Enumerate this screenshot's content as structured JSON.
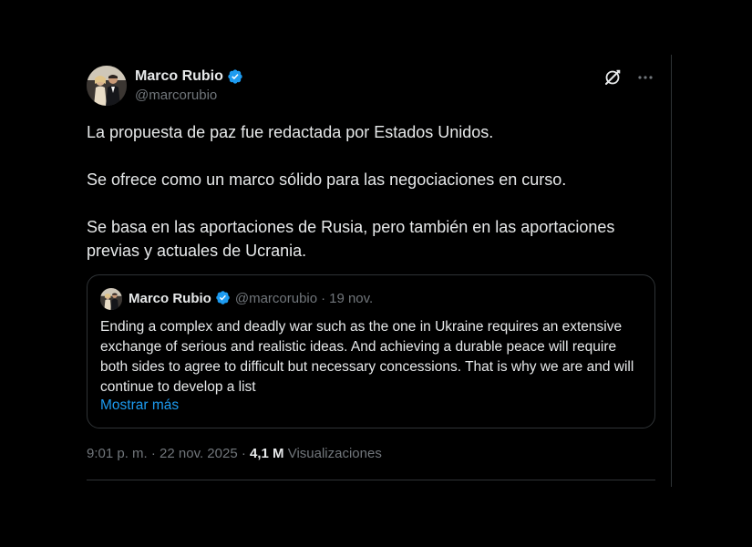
{
  "author": {
    "display_name": "Marco Rubio",
    "handle": "@marcorubio"
  },
  "icons": {
    "verified": "verified-badge-icon",
    "grok": "grok-icon",
    "more": "more-icon",
    "verified_color": "#1d9bf0"
  },
  "post": {
    "paragraphs": [
      "La propuesta de paz fue redactada por Estados Unidos.",
      "Se ofrece como un marco sólido para las negociaciones en curso.",
      "Se basa en las aportaciones de Rusia, pero también en las aportaciones previas y actuales de Ucrania."
    ]
  },
  "quoted": {
    "display_name": "Marco Rubio",
    "handle": "@marcorubio",
    "separator": "·",
    "date": "19 nov.",
    "text": "Ending a complex and deadly war such as the one in Ukraine requires an extensive exchange of serious and realistic ideas. And achieving a durable peace will require both sides to agree to difficult but necessary concessions. That is why we are and will continue to develop a list",
    "show_more": "Mostrar más"
  },
  "meta": {
    "time": "9:01 p. m.",
    "separator": "·",
    "date": "22 nov. 2025",
    "views_count": "4,1 M",
    "views_label": "Visualizaciones"
  },
  "colors": {
    "background": "#000000",
    "text_primary": "#e7e9ea",
    "text_secondary": "#71767b",
    "link": "#1d9bf0",
    "border": "#2f3336"
  }
}
